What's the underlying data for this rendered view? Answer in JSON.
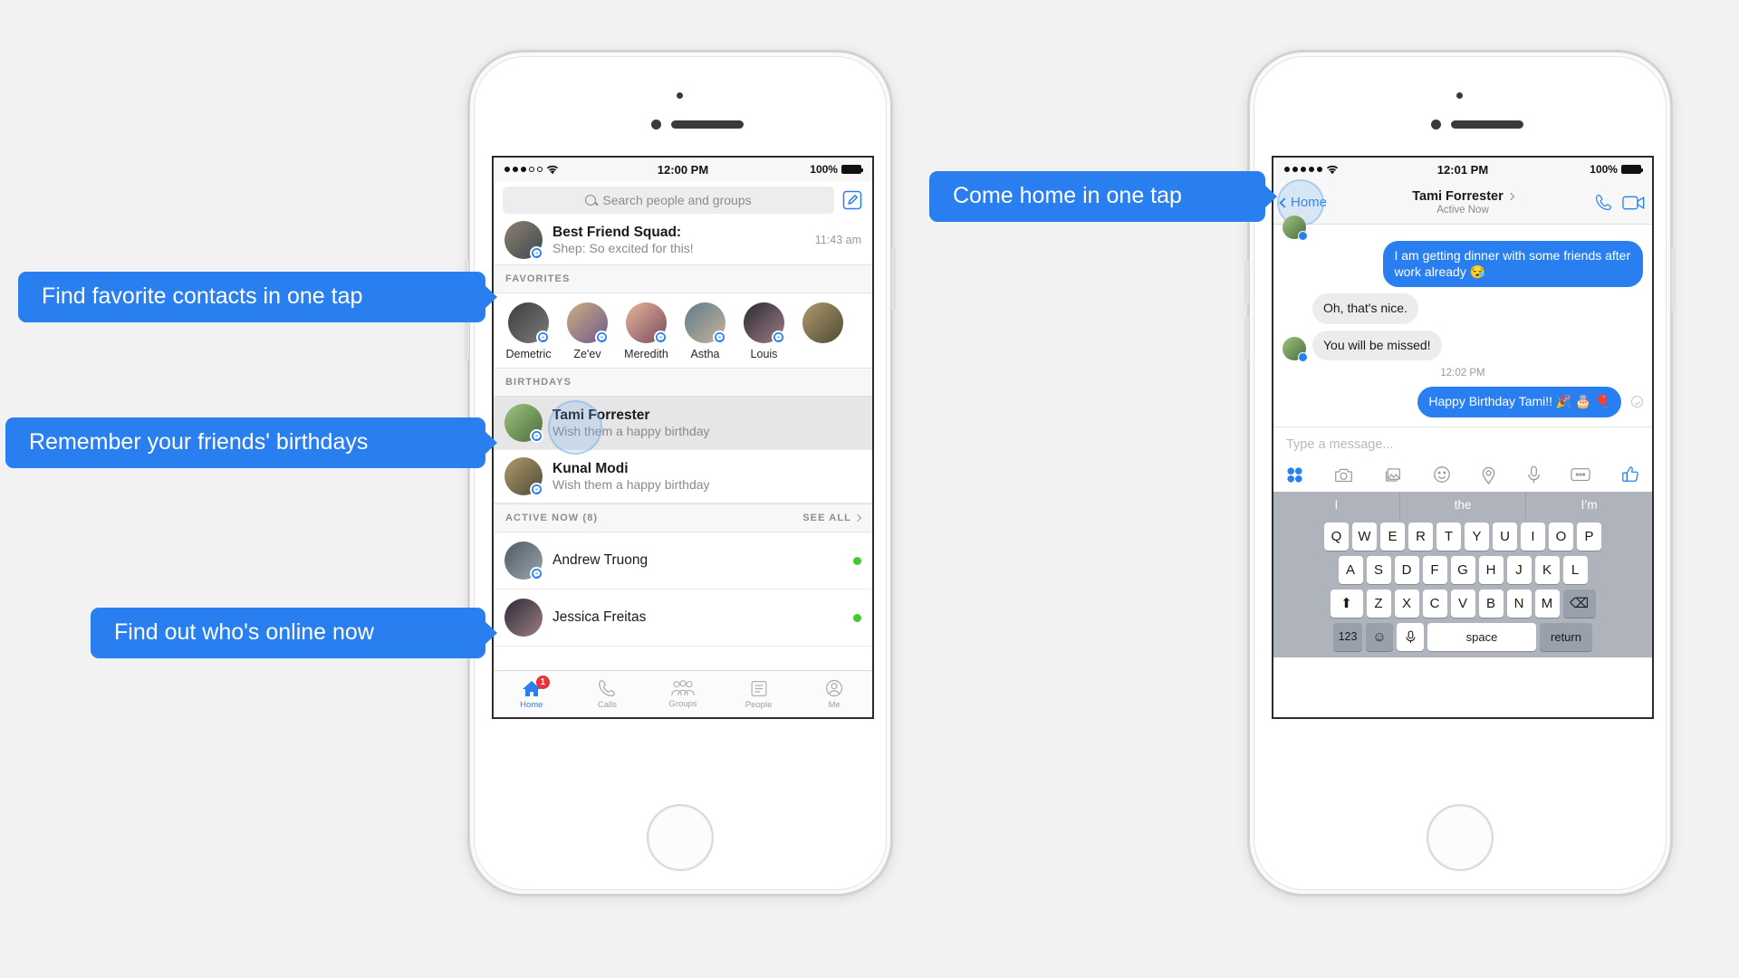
{
  "colors": {
    "accent": "#2a7ff0",
    "online": "#3ecb2b",
    "badge": "#e8333a",
    "page_bg": "#f2f2f2"
  },
  "callouts": [
    {
      "id": "favorites",
      "text": "Find favorite contacts in one tap"
    },
    {
      "id": "birthdays",
      "text": "Remember your friends' birthdays"
    },
    {
      "id": "online",
      "text": "Find out who's online now"
    },
    {
      "id": "home",
      "text": "Come home in one tap"
    }
  ],
  "left_phone": {
    "status_bar": {
      "time": "12:00 PM",
      "battery": "100%",
      "signal_dots": 5,
      "signal_filled": 3
    },
    "search": {
      "placeholder": "Search people and groups"
    },
    "compose_icon": "compose-icon",
    "top_thread": {
      "title": "Best Friend Squad:",
      "preview": "Shep: So excited for this!",
      "time": "11:43 am"
    },
    "sections": {
      "favorites": {
        "header": "FAVORITES"
      },
      "birthdays": {
        "header": "BIRTHDAYS"
      },
      "active": {
        "header": "ACTIVE NOW (8)",
        "see_all": "SEE ALL"
      }
    },
    "favorites": [
      {
        "name": "Demetric"
      },
      {
        "name": "Ze'ev"
      },
      {
        "name": "Meredith"
      },
      {
        "name": "Astha"
      },
      {
        "name": "Louis"
      }
    ],
    "birthdays": [
      {
        "name": "Tami Forrester",
        "sub": "Wish them a happy birthday",
        "highlighted": true
      },
      {
        "name": "Kunal Modi",
        "sub": "Wish them a happy birthday",
        "highlighted": false
      }
    ],
    "active_now": [
      {
        "name": "Andrew Truong",
        "online": true
      },
      {
        "name": "Jessica Freitas",
        "online": true
      }
    ],
    "tabs": [
      {
        "label": "Home",
        "icon": "home-icon",
        "active": true,
        "badge": "1"
      },
      {
        "label": "Calls",
        "icon": "phone-icon",
        "active": false,
        "badge": ""
      },
      {
        "label": "Groups",
        "icon": "groups-icon",
        "active": false,
        "badge": ""
      },
      {
        "label": "People",
        "icon": "people-icon",
        "active": false,
        "badge": ""
      },
      {
        "label": "Me",
        "icon": "me-icon",
        "active": false,
        "badge": ""
      }
    ]
  },
  "right_phone": {
    "status_bar": {
      "time": "12:01 PM",
      "battery": "100%",
      "signal_dots": 5,
      "signal_filled": 5
    },
    "header": {
      "back_label": "Home",
      "title": "Tami Forrester",
      "subtitle": "Active Now",
      "call_icon": "phone-icon",
      "video_icon": "video-camera-icon"
    },
    "messages": [
      {
        "from": "out",
        "text": "I am getting dinner with some friends after work already 😪"
      },
      {
        "from": "in",
        "text": "Oh, that's nice."
      },
      {
        "from": "in",
        "text": "You will be missed!",
        "avatar": true
      }
    ],
    "timestamp": "12:02 PM",
    "last_message": {
      "from": "out",
      "text": "Happy Birthday Tami!! 🎉 🎂 🎈",
      "seen": true
    },
    "composer": {
      "placeholder": "Type a message..."
    },
    "composer_icons": [
      "apps-grid-icon",
      "camera-icon",
      "photos-icon",
      "emoji-icon",
      "location-pin-icon",
      "microphone-icon",
      "more-dots-icon",
      "thumbs-up-icon"
    ],
    "keyboard": {
      "predictions": [
        "I",
        "the",
        "I’m"
      ],
      "row1": [
        "Q",
        "W",
        "E",
        "R",
        "T",
        "Y",
        "U",
        "I",
        "O",
        "P"
      ],
      "row2": [
        "A",
        "S",
        "D",
        "F",
        "G",
        "H",
        "J",
        "K",
        "L"
      ],
      "row3": [
        "Z",
        "X",
        "C",
        "V",
        "B",
        "N",
        "M"
      ],
      "shift_label": "⬆",
      "backspace_label": "⌫",
      "numbers_label": "123",
      "emoji_label": "☺",
      "mic_label": "mic",
      "space_label": "space",
      "return_label": "return"
    }
  }
}
